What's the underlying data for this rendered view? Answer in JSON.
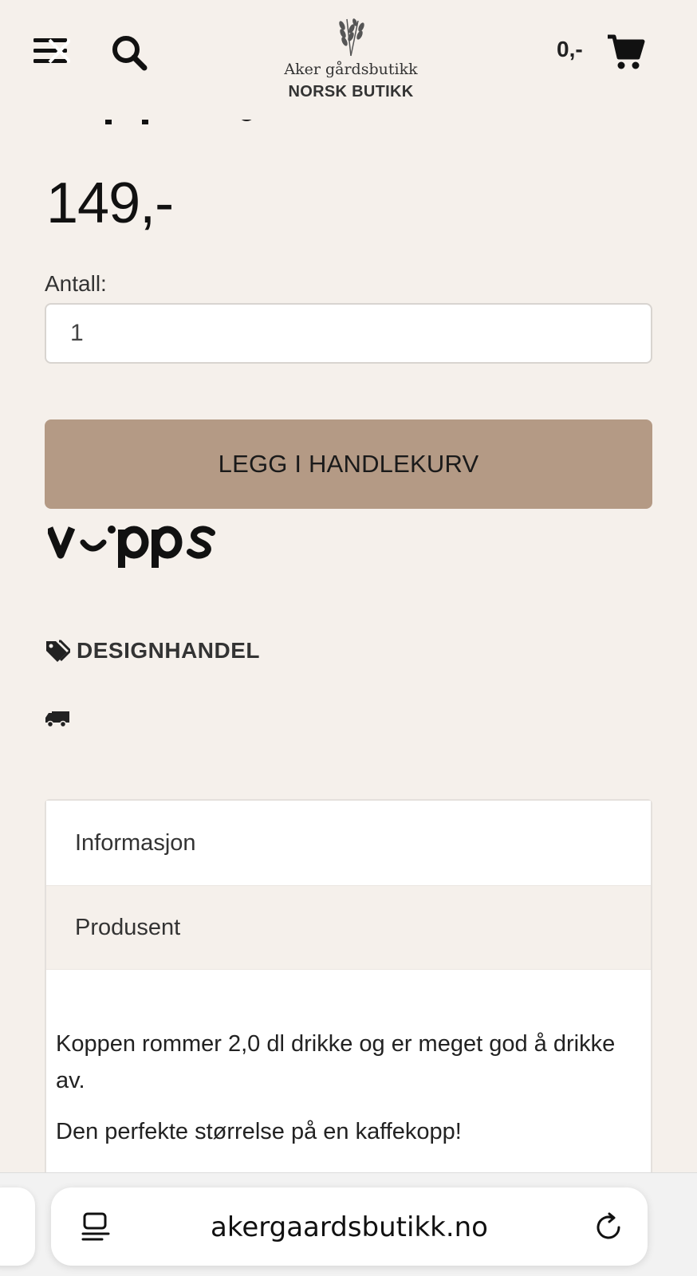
{
  "header": {
    "logo_name": "Aker gårdsbutikk",
    "logo_subtitle": "NORSK BUTIKK",
    "cart_total": "0,-",
    "menu_icon": "menu-close-icon",
    "search_icon": "search-icon",
    "cart_icon": "cart-icon"
  },
  "product": {
    "price": "149,-",
    "quantity_label": "Antall:",
    "quantity_value": "1",
    "add_to_cart_label": "LEGG I HANDLEKURV",
    "payment_logo_text": "vipps",
    "tag_label": "DESIGNHANDEL"
  },
  "tabs": {
    "info_label": "Informasjon",
    "producer_label": "Produsent",
    "content": {
      "paragraph1": " Koppen rommer 2,0 dl drikke og er meget god å drikke av.",
      "paragraph2": "Den perfekte størrelse på en kaffekopp!"
    }
  },
  "browser": {
    "url": "akergaardsbutikk.no",
    "reader_icon": "reader-icon",
    "reload_icon": "reload-icon"
  },
  "colors": {
    "background": "#f5f0eb",
    "button": "#b49a85",
    "text": "#1a1a1a"
  }
}
